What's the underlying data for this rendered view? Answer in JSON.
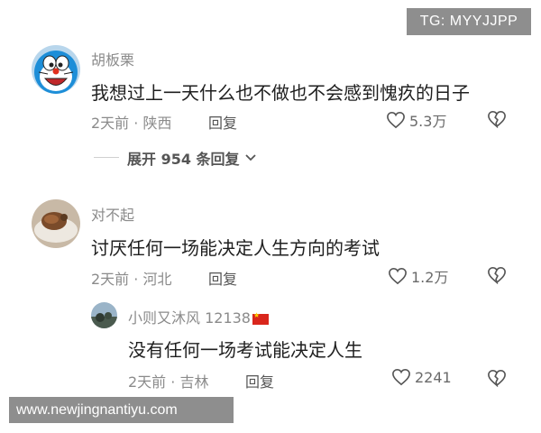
{
  "watermarks": {
    "top": "TG: MYYJJPP",
    "bottom": "www.newjingnantiyu.com"
  },
  "comments": [
    {
      "username": "胡板栗",
      "text": "我想过上一天什么也不做也不会感到愧疚的日子",
      "time_location": "2天前 · 陕西",
      "reply_label": "回复",
      "likes": "5.3万",
      "avatar": "doraemon-avatar"
    },
    {
      "username": "对不起",
      "text": "讨厌任何一场能决定人生方向的考试",
      "time_location": "2天前 · 河北",
      "reply_label": "回复",
      "likes": "1.2万",
      "avatar": "food-avatar"
    }
  ],
  "expand_replies": "展开 954 条回复",
  "reply": {
    "username": "小则又沐风 12138",
    "text": "没有任何一场考试能决定人生",
    "time_location": "2天前 · 吉林",
    "reply_label": "回复",
    "likes": "2241",
    "avatar": "landscape-avatar"
  },
  "icons": {
    "like": "heart-outline-icon",
    "dislike": "broken-heart-icon",
    "chevron": "chevron-down-icon",
    "flag": "china-flag-icon"
  },
  "colors": {
    "text": "#1f1f1f",
    "meta": "#8b8b8b",
    "watermark_bg": "#8e8e8e"
  }
}
